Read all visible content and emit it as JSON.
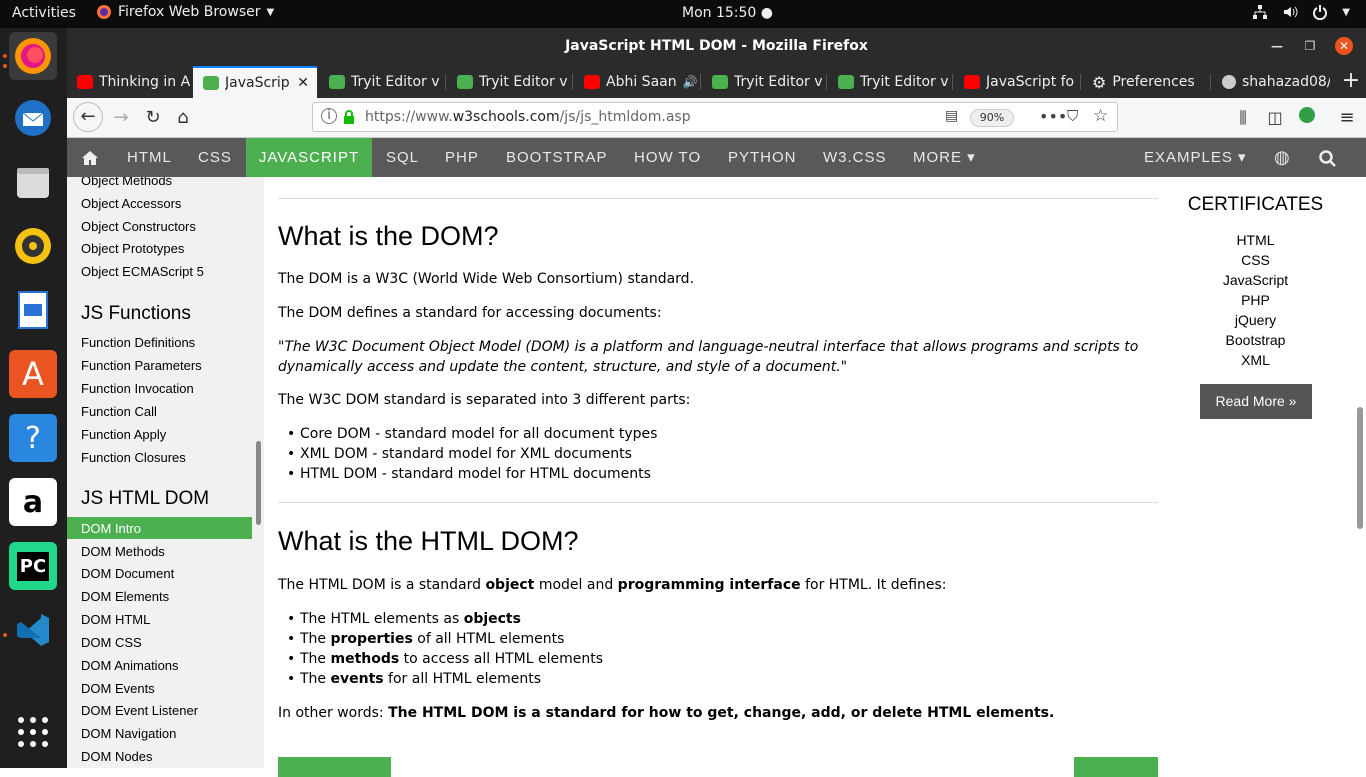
{
  "topbar": {
    "activities": "Activities",
    "app_name": "Firefox Web Browser",
    "clock": "Mon 15:50"
  },
  "window": {
    "title": "JavaScript HTML DOM - Mozilla Firefox"
  },
  "tabs": [
    {
      "label": "Thinking in A",
      "color": "#ff0000"
    },
    {
      "label": "JavaScrip",
      "color": "#4caf50"
    },
    {
      "label": "Tryit Editor v",
      "color": "#4caf50"
    },
    {
      "label": "Tryit Editor v",
      "color": "#4caf50"
    },
    {
      "label": "Abhi Saan",
      "color": "#ff0000"
    },
    {
      "label": "Tryit Editor v",
      "color": "#4caf50"
    },
    {
      "label": "Tryit Editor v",
      "color": "#4caf50"
    },
    {
      "label": "JavaScript fo",
      "color": "#ff0000"
    },
    {
      "label": "Preferences",
      "color": "#cccccc"
    },
    {
      "label": "shahazad08/",
      "color": "#cccccc"
    }
  ],
  "url": {
    "prefix": "https://www.",
    "domain": "w3schools.com",
    "path": "/js/js_htmldom.asp",
    "zoom": "90%"
  },
  "w3nav": {
    "items": [
      "HTML",
      "CSS",
      "JAVASCRIPT",
      "SQL",
      "PHP",
      "BOOTSTRAP",
      "HOW TO",
      "PYTHON",
      "W3.CSS",
      "MORE ▾"
    ],
    "examples": "EXAMPLES ▾"
  },
  "sidebar": {
    "object_links": [
      "Object Methods",
      "Object Accessors",
      "Object Constructors",
      "Object Prototypes",
      "Object ECMAScript 5"
    ],
    "functions_head": "JS Functions",
    "function_links": [
      "Function Definitions",
      "Function Parameters",
      "Function Invocation",
      "Function Call",
      "Function Apply",
      "Function Closures"
    ],
    "dom_head": "JS HTML DOM",
    "dom_links": [
      "DOM Intro",
      "DOM Methods",
      "DOM Document",
      "DOM Elements",
      "DOM HTML",
      "DOM CSS",
      "DOM Animations",
      "DOM Events",
      "DOM Event Listener",
      "DOM Navigation",
      "DOM Nodes"
    ]
  },
  "main": {
    "h1": "What is the DOM?",
    "p1": "The DOM is a W3C (World Wide Web Consortium) standard.",
    "p2": "The DOM defines a standard for accessing documents:",
    "quote1": "\"The W3C Document Object Model (DOM) is a platform and language-neutral interface that allows programs and scripts to",
    "quote2": "dynamically access and update the content, structure, and style of a document.\"",
    "p3": "The W3C DOM standard is separated into 3 different parts:",
    "parts": [
      "Core DOM - standard model for all document types",
      "XML DOM - standard model for XML documents",
      "HTML DOM - standard model for HTML documents"
    ],
    "h2": "What is the HTML DOM?",
    "p4a": "The HTML DOM is a standard ",
    "p4b": "object",
    "p4c": " model and ",
    "p4d": "programming interface",
    "p4e": " for HTML. It defines:",
    "defs": [
      {
        "pre": "The HTML elements as ",
        "bold": "objects",
        "post": ""
      },
      {
        "pre": "The ",
        "bold": "properties",
        "post": " of all HTML elements"
      },
      {
        "pre": "The ",
        "bold": "methods",
        "post": " to access all HTML elements"
      },
      {
        "pre": "The ",
        "bold": "events",
        "post": " for all HTML elements"
      }
    ],
    "p5a": "In other words: ",
    "p5b": "The HTML DOM is a standard for how to get, change, add, or delete HTML elements."
  },
  "right": {
    "title": "CERTIFICATES",
    "items": [
      "HTML",
      "CSS",
      "JavaScript",
      "PHP",
      "jQuery",
      "Bootstrap",
      "XML"
    ],
    "read_more": "Read More »"
  }
}
